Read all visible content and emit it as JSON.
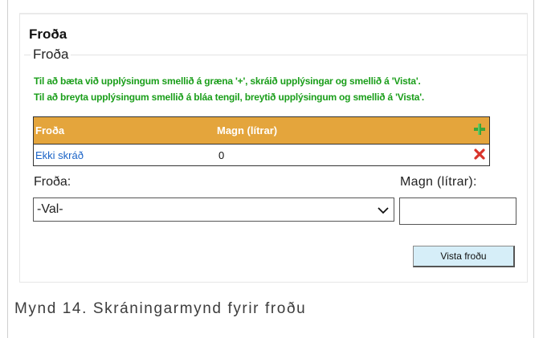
{
  "panel": {
    "title": "Froða",
    "legend": "Froða",
    "hints": [
      "Til að bæta við upplýsingum smellið á græna '+', skráið upplýsingar og smellið á 'Vista'.",
      "Til að breyta upplýsingum smellið á bláa tengil, breytið upplýsingum og smellið á 'Vista'."
    ]
  },
  "grid": {
    "columns": [
      "Froða",
      "Magn (lítrar)"
    ],
    "add_icon": "plus-icon",
    "rows": [
      {
        "froda": "Ekki skráð",
        "magn": "0",
        "delete_icon": "x-icon"
      }
    ]
  },
  "form": {
    "froda_label": "Froða:",
    "froda_value": "-Val-",
    "magn_label": "Magn (lítrar):",
    "magn_value": "",
    "save_label": "Vista froðu"
  },
  "caption": "Mynd 14. Skráningarmynd fyrir froðu",
  "colors": {
    "header_bg": "#e4a53c",
    "hint_text": "#1a9e1a",
    "link": "#1a63c7",
    "add_icon": "#3aa63a",
    "delete_icon": "#d9342b",
    "button_bg": "#d6eef8"
  }
}
